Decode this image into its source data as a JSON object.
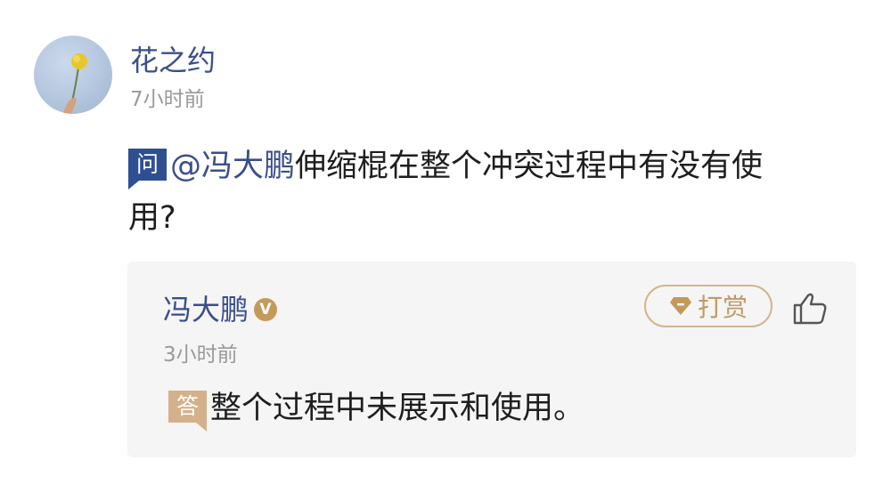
{
  "question": {
    "user_name": "花之约",
    "time": "7小时前",
    "tag": "问",
    "mention": "@冯大鹏",
    "text": "伸缩棍在整个冲突过程中有没有使用?"
  },
  "answer": {
    "user_name": "冯大鹏",
    "verified_badge": "V",
    "time": "3小时前",
    "reward_label": "打赏",
    "tag": "答",
    "text": "整个过程中未展示和使用。"
  },
  "icons": {
    "avatar": "avatar-flower-photo",
    "verified": "verified-badge-icon",
    "reward": "gem-icon",
    "like": "thumbs-up-icon"
  },
  "colors": {
    "name_blue": "#3a4f8a",
    "question_tag": "#2f4f93",
    "answer_tag": "#d3b18a",
    "reward_gold": "#c49a5a",
    "card_bg": "#f5f5f5"
  }
}
